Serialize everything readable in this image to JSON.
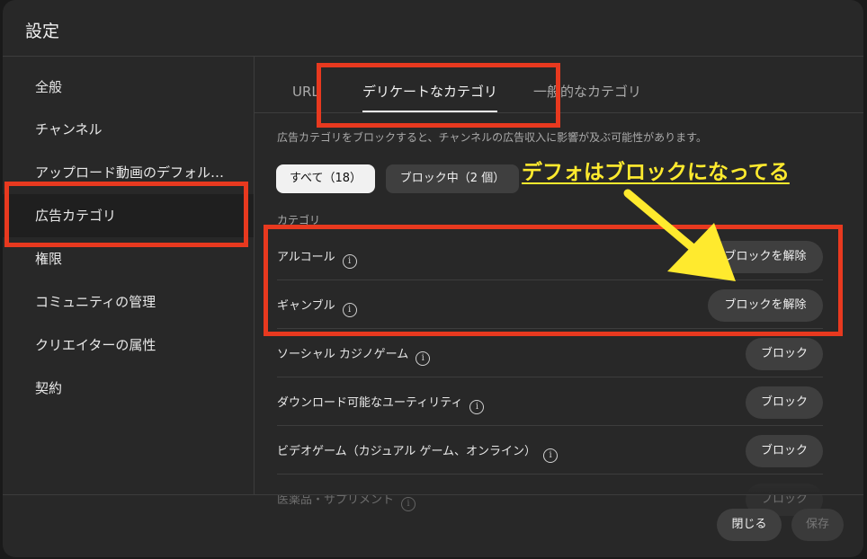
{
  "dialog": {
    "title": "設定"
  },
  "sidebar": {
    "items": [
      {
        "label": "全般"
      },
      {
        "label": "チャンネル"
      },
      {
        "label": "アップロード動画のデフォル…"
      },
      {
        "label": "広告カテゴリ"
      },
      {
        "label": "権限"
      },
      {
        "label": "コミュニティの管理"
      },
      {
        "label": "クリエイターの属性"
      },
      {
        "label": "契約"
      }
    ],
    "active_index": 3
  },
  "tabs": [
    {
      "label": "URL"
    },
    {
      "label": "デリケートなカテゴリ"
    },
    {
      "label": "一般的なカテゴリ"
    }
  ],
  "description": "広告カテゴリをブロックすると、チャンネルの広告収入に影響が及ぶ可能性があります。",
  "filters": {
    "all": "すべて（18）",
    "blocked": "ブロック中（2 個）"
  },
  "section_label": "カテゴリ",
  "rows": [
    {
      "label": "アルコール",
      "button": "ブロックを解除"
    },
    {
      "label": "ギャンブル",
      "button": "ブロックを解除"
    },
    {
      "label": "ソーシャル カジノゲーム",
      "button": "ブロック"
    },
    {
      "label": "ダウンロード可能なユーティリティ",
      "button": "ブロック"
    },
    {
      "label": "ビデオゲーム（カジュアル ゲーム、オンライン）",
      "button": "ブロック"
    },
    {
      "label": "医薬品・サプリメント",
      "button": "ブロック"
    }
  ],
  "info_glyph": "i",
  "footer": {
    "close": "閉じる",
    "save": "保存"
  },
  "annotation": {
    "text": "デフォはブロックになってる",
    "color": "#ffea2e",
    "highlight_color": "#e8391f"
  }
}
